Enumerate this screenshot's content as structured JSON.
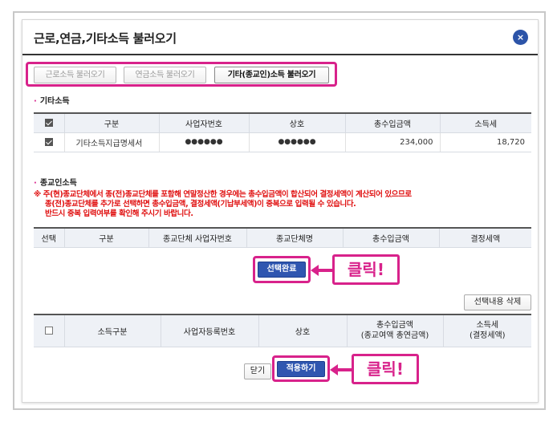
{
  "dialog": {
    "title": "근로,연금,기타소득 불러오기",
    "close_icon": "×"
  },
  "tabs": {
    "labor": "근로소득 불러오기",
    "pension": "연금소득 불러오기",
    "other": "기타(종교인)소득 불러오기"
  },
  "other_income": {
    "section_title": "기타소득",
    "columns": [
      "구분",
      "사업자번호",
      "상호",
      "총수입금액",
      "소득세"
    ],
    "rows": [
      {
        "type": "기타소득지급명세서",
        "biz_no": "●●●●●●",
        "name": "●●●●●●",
        "total": "234,000",
        "tax": "18,720"
      }
    ]
  },
  "religious_income": {
    "section_title": "종교인소득",
    "notice": [
      "※ 주(현)종교단체에서 종(전)종교단체를 포함해 연말정산한 경우에는 총수입금액이 합산되어 결정세액이 계산되어 있으므로",
      "종(전)종교단체를 추가로 선택하면 총수입금액, 결정세액(기납부세액)이 중복으로 입력될 수 있습니다.",
      "반드시 중복 입력여부를 확인해 주시기 바랍니다."
    ],
    "columns": [
      "선택",
      "구분",
      "종교단체 사업자번호",
      "종교단체명",
      "총수입금액",
      "결정세액"
    ],
    "select_done": "선택완료"
  },
  "bottom_grid": {
    "delete_button": "선택내용 삭제",
    "col_type": "소득구분",
    "col_bizno": "사업자등록번호",
    "col_name": "상호",
    "col_total_1": "총수입금액",
    "col_total_2": "(종교여액 총연금액)",
    "col_tax_1": "소득세",
    "col_tax_2": "(결정세액)"
  },
  "footer": {
    "close": "닫기",
    "apply": "적용하기"
  },
  "annotations": {
    "click_1": "클릭!",
    "click_2": "클릭!"
  },
  "colors": {
    "highlight": "#d8228b",
    "primary": "#2f56b0",
    "notice": "#e01010"
  }
}
